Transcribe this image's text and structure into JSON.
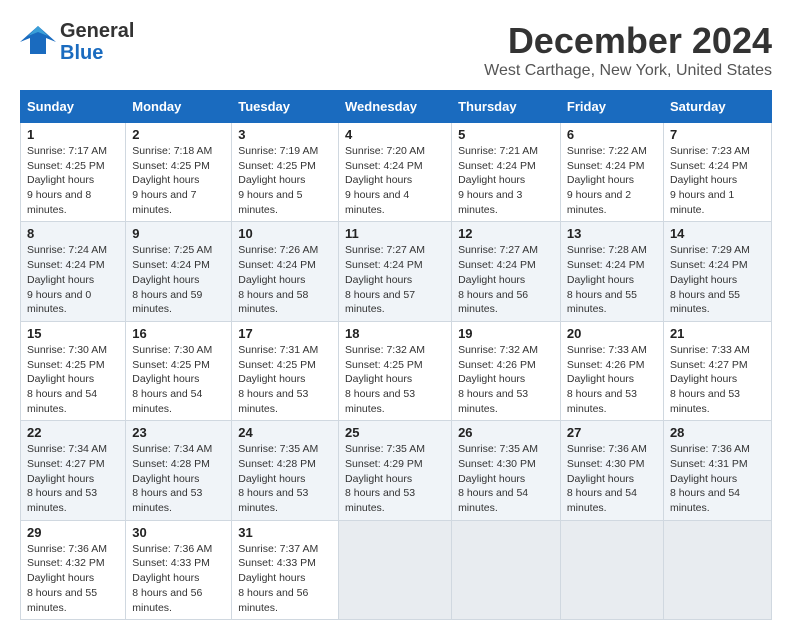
{
  "logo": {
    "line1": "General",
    "line2": "Blue"
  },
  "title": "December 2024",
  "subtitle": "West Carthage, New York, United States",
  "days_of_week": [
    "Sunday",
    "Monday",
    "Tuesday",
    "Wednesday",
    "Thursday",
    "Friday",
    "Saturday"
  ],
  "weeks": [
    [
      {
        "day": "1",
        "sunrise": "7:17 AM",
        "sunset": "4:25 PM",
        "daylight": "9 hours and 8 minutes."
      },
      {
        "day": "2",
        "sunrise": "7:18 AM",
        "sunset": "4:25 PM",
        "daylight": "9 hours and 7 minutes."
      },
      {
        "day": "3",
        "sunrise": "7:19 AM",
        "sunset": "4:25 PM",
        "daylight": "9 hours and 5 minutes."
      },
      {
        "day": "4",
        "sunrise": "7:20 AM",
        "sunset": "4:24 PM",
        "daylight": "9 hours and 4 minutes."
      },
      {
        "day": "5",
        "sunrise": "7:21 AM",
        "sunset": "4:24 PM",
        "daylight": "9 hours and 3 minutes."
      },
      {
        "day": "6",
        "sunrise": "7:22 AM",
        "sunset": "4:24 PM",
        "daylight": "9 hours and 2 minutes."
      },
      {
        "day": "7",
        "sunrise": "7:23 AM",
        "sunset": "4:24 PM",
        "daylight": "9 hours and 1 minute."
      }
    ],
    [
      {
        "day": "8",
        "sunrise": "7:24 AM",
        "sunset": "4:24 PM",
        "daylight": "9 hours and 0 minutes."
      },
      {
        "day": "9",
        "sunrise": "7:25 AM",
        "sunset": "4:24 PM",
        "daylight": "8 hours and 59 minutes."
      },
      {
        "day": "10",
        "sunrise": "7:26 AM",
        "sunset": "4:24 PM",
        "daylight": "8 hours and 58 minutes."
      },
      {
        "day": "11",
        "sunrise": "7:27 AM",
        "sunset": "4:24 PM",
        "daylight": "8 hours and 57 minutes."
      },
      {
        "day": "12",
        "sunrise": "7:27 AM",
        "sunset": "4:24 PM",
        "daylight": "8 hours and 56 minutes."
      },
      {
        "day": "13",
        "sunrise": "7:28 AM",
        "sunset": "4:24 PM",
        "daylight": "8 hours and 55 minutes."
      },
      {
        "day": "14",
        "sunrise": "7:29 AM",
        "sunset": "4:24 PM",
        "daylight": "8 hours and 55 minutes."
      }
    ],
    [
      {
        "day": "15",
        "sunrise": "7:30 AM",
        "sunset": "4:25 PM",
        "daylight": "8 hours and 54 minutes."
      },
      {
        "day": "16",
        "sunrise": "7:30 AM",
        "sunset": "4:25 PM",
        "daylight": "8 hours and 54 minutes."
      },
      {
        "day": "17",
        "sunrise": "7:31 AM",
        "sunset": "4:25 PM",
        "daylight": "8 hours and 53 minutes."
      },
      {
        "day": "18",
        "sunrise": "7:32 AM",
        "sunset": "4:25 PM",
        "daylight": "8 hours and 53 minutes."
      },
      {
        "day": "19",
        "sunrise": "7:32 AM",
        "sunset": "4:26 PM",
        "daylight": "8 hours and 53 minutes."
      },
      {
        "day": "20",
        "sunrise": "7:33 AM",
        "sunset": "4:26 PM",
        "daylight": "8 hours and 53 minutes."
      },
      {
        "day": "21",
        "sunrise": "7:33 AM",
        "sunset": "4:27 PM",
        "daylight": "8 hours and 53 minutes."
      }
    ],
    [
      {
        "day": "22",
        "sunrise": "7:34 AM",
        "sunset": "4:27 PM",
        "daylight": "8 hours and 53 minutes."
      },
      {
        "day": "23",
        "sunrise": "7:34 AM",
        "sunset": "4:28 PM",
        "daylight": "8 hours and 53 minutes."
      },
      {
        "day": "24",
        "sunrise": "7:35 AM",
        "sunset": "4:28 PM",
        "daylight": "8 hours and 53 minutes."
      },
      {
        "day": "25",
        "sunrise": "7:35 AM",
        "sunset": "4:29 PM",
        "daylight": "8 hours and 53 minutes."
      },
      {
        "day": "26",
        "sunrise": "7:35 AM",
        "sunset": "4:30 PM",
        "daylight": "8 hours and 54 minutes."
      },
      {
        "day": "27",
        "sunrise": "7:36 AM",
        "sunset": "4:30 PM",
        "daylight": "8 hours and 54 minutes."
      },
      {
        "day": "28",
        "sunrise": "7:36 AM",
        "sunset": "4:31 PM",
        "daylight": "8 hours and 54 minutes."
      }
    ],
    [
      {
        "day": "29",
        "sunrise": "7:36 AM",
        "sunset": "4:32 PM",
        "daylight": "8 hours and 55 minutes."
      },
      {
        "day": "30",
        "sunrise": "7:36 AM",
        "sunset": "4:33 PM",
        "daylight": "8 hours and 56 minutes."
      },
      {
        "day": "31",
        "sunrise": "7:37 AM",
        "sunset": "4:33 PM",
        "daylight": "8 hours and 56 minutes."
      },
      null,
      null,
      null,
      null
    ]
  ],
  "labels": {
    "sunrise": "Sunrise:",
    "sunset": "Sunset:",
    "daylight": "Daylight hours"
  }
}
